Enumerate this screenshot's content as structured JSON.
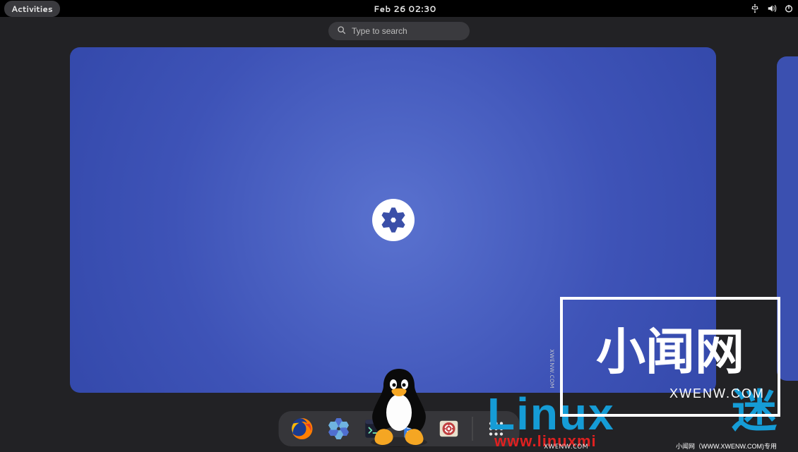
{
  "topbar": {
    "activities_label": "Activities",
    "clock": "Feb 26  02:30"
  },
  "search": {
    "placeholder": "Type to search"
  },
  "dock": {
    "apps": [
      {
        "name": "firefox-icon"
      },
      {
        "name": "nixos-icon"
      },
      {
        "name": "terminal-icon"
      },
      {
        "name": "files-icon"
      },
      {
        "name": "help-icon"
      }
    ]
  },
  "watermarks": {
    "linux_word": "Linux",
    "linux_url": "www.linuxmi",
    "linux_mi": "迷",
    "box_title": "小闻网",
    "box_sub": "XWENW.COM",
    "vertical": "XWENW.COM",
    "footer_left": "XWENW.COM",
    "footer_right": "小闻网（WWW.XWENW.COM)专用"
  }
}
